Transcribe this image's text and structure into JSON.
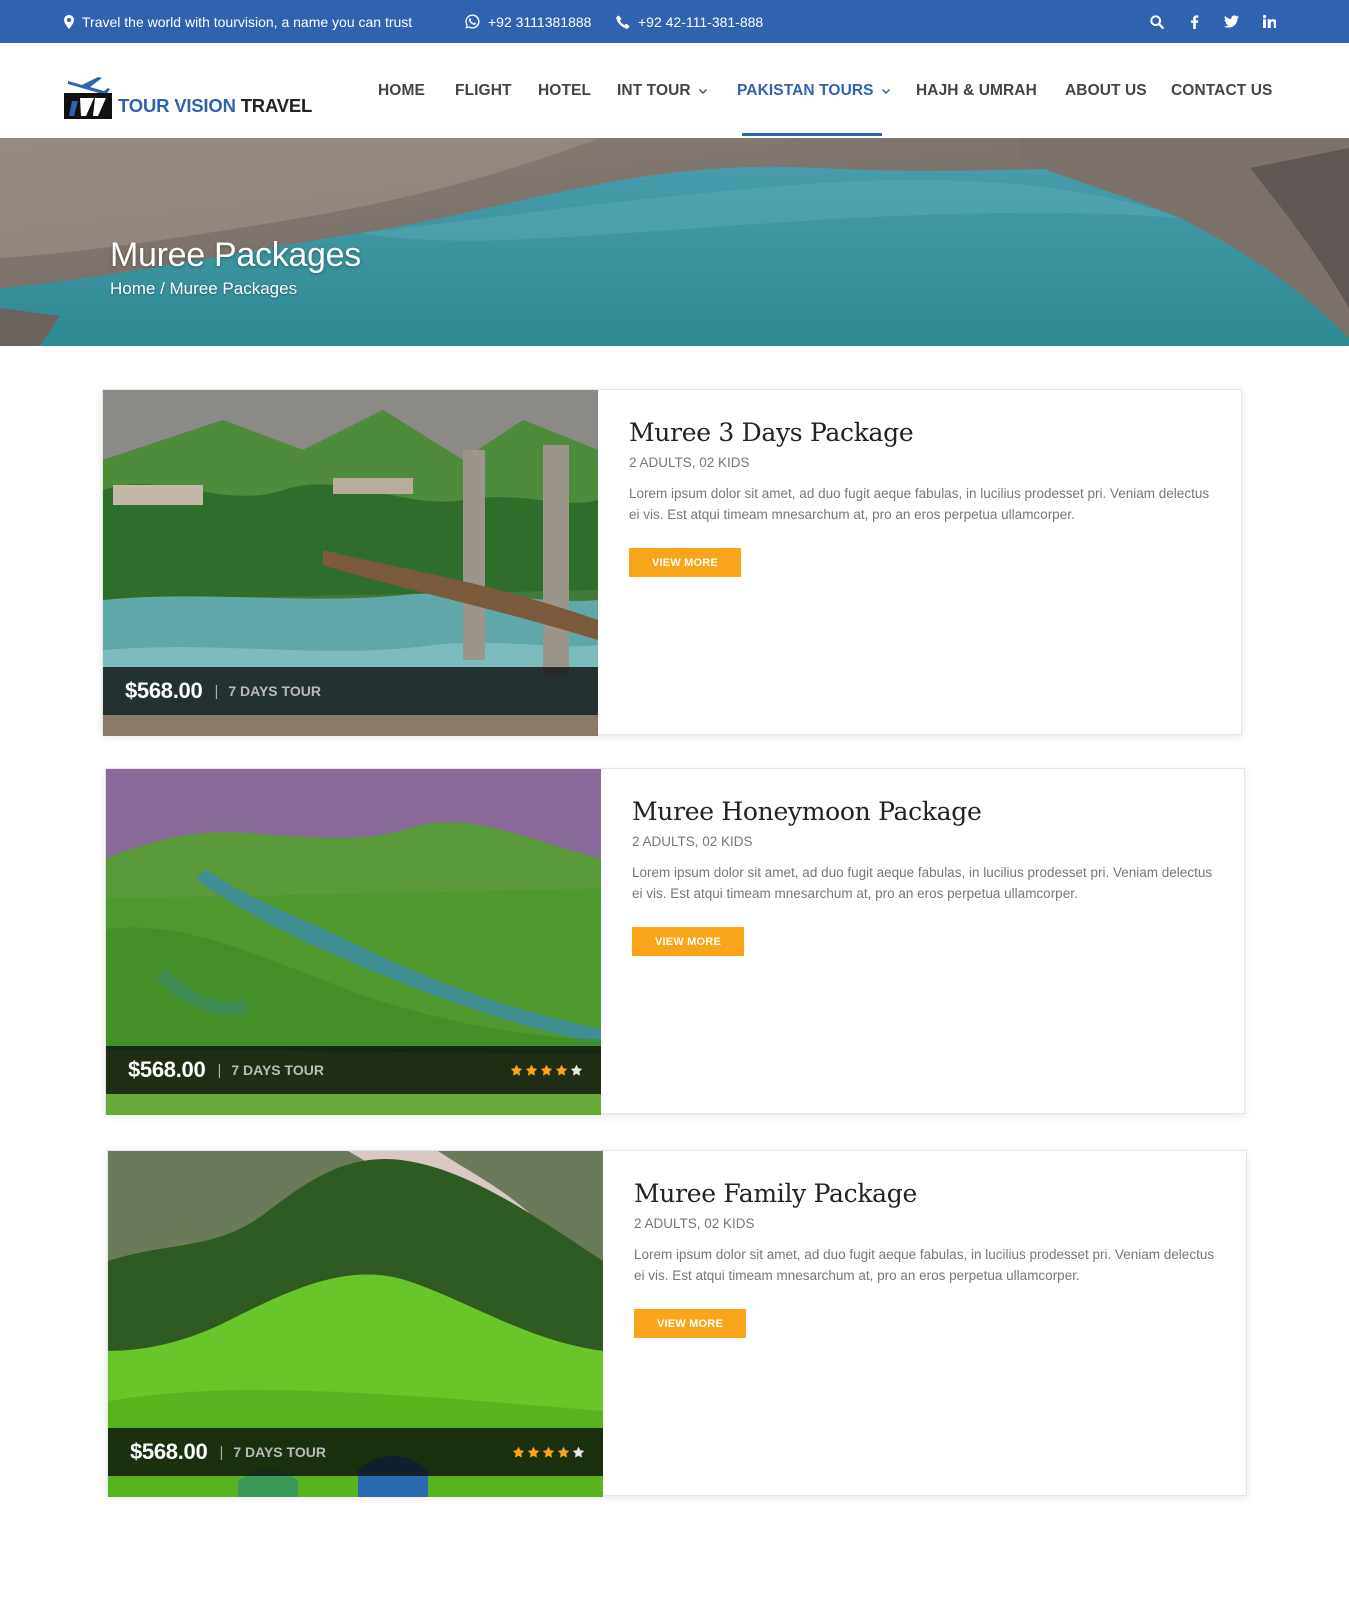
{
  "topbar": {
    "tagline": "Travel the world with tourvision, a name you can trust",
    "whatsapp": "+92 3111381888",
    "phone": "+92 42-111-381-888"
  },
  "brand": {
    "name_part1": "TOUR VISION",
    "name_part2": "TRAVEL"
  },
  "nav": {
    "items": [
      {
        "label": "HOME"
      },
      {
        "label": "FLIGHT"
      },
      {
        "label": "HOTEL"
      },
      {
        "label": "INT TOUR"
      },
      {
        "label": "PAKISTAN TOURS"
      },
      {
        "label": "HAJH & UMRAH"
      },
      {
        "label": "ABOUT US"
      },
      {
        "label": "CONTACT US"
      }
    ],
    "active": "PAKISTAN TOURS"
  },
  "hero": {
    "title": "Muree Packages",
    "breadcrumb": "Home / Muree Packages"
  },
  "packages": [
    {
      "title": "Muree 3 Days Package",
      "guests": "2 ADULTS, 02 KIDS",
      "description": "Lorem ipsum dolor sit amet, ad duo fugit aeque fabulas, in lucilius prodesset pri. Veniam delectus ei vis. Est atqui timeam mnesarchum at, pro an eros perpetua ullamcorper.",
      "button": "VIEW MORE",
      "price": "$568.00",
      "separator": "|",
      "duration": "7 DAYS TOUR",
      "rating": null
    },
    {
      "title": "Muree Honeymoon Package",
      "guests": "2 ADULTS, 02 KIDS",
      "description": "Lorem ipsum dolor sit amet, ad duo fugit aeque fabulas, in lucilius prodesset pri. Veniam delectus ei vis. Est atqui timeam mnesarchum at, pro an eros perpetua ullamcorper.",
      "button": "VIEW MORE",
      "price": "$568.00",
      "separator": "|",
      "duration": "7 DAYS TOUR",
      "rating": 4
    },
    {
      "title": "Muree Family Package",
      "guests": "2 ADULTS, 02 KIDS",
      "description": "Lorem ipsum dolor sit amet, ad duo fugit aeque fabulas, in lucilius prodesset pri. Veniam delectus ei vis. Est atqui timeam mnesarchum at, pro an eros perpetua ullamcorper.",
      "button": "VIEW MORE",
      "price": "$568.00",
      "separator": "|",
      "duration": "7 DAYS TOUR",
      "rating": 4
    }
  ],
  "colors": {
    "primary": "#2f63b0",
    "button": "#f9a51a",
    "star": "#f9a51a"
  }
}
